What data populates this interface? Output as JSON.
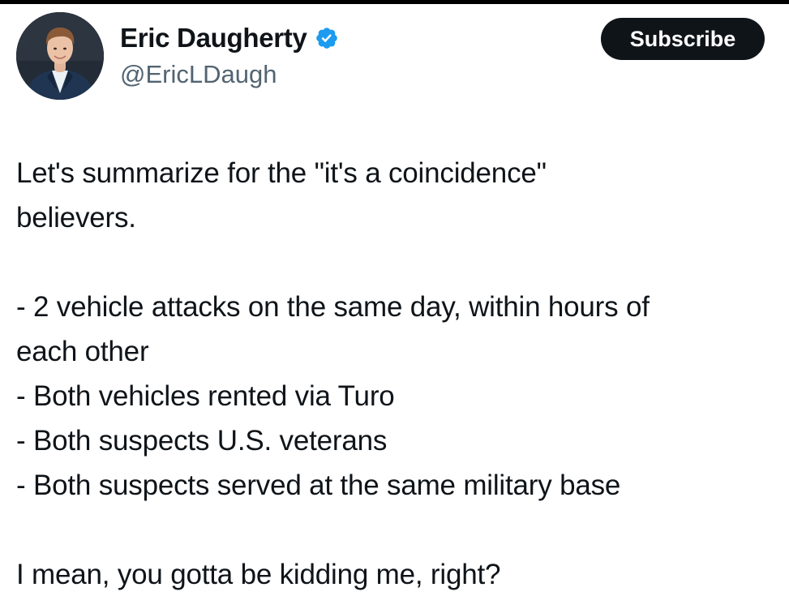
{
  "author": {
    "display_name": "Eric Daugherty",
    "handle": "@EricLDaugh",
    "verified": true,
    "verified_color": "#1d9bf0"
  },
  "actions": {
    "subscribe_label": "Subscribe"
  },
  "tweet": {
    "intro_lines": [
      "Let's summarize for the \"it's a coincidence\"",
      "believers."
    ],
    "list_lines": [
      "- 2 vehicle attacks on the same day, within hours of",
      "each other",
      "- Both vehicles rented via Turo",
      "- Both suspects U.S. veterans",
      "- Both suspects served at the same military base"
    ],
    "closing_line": "I mean, you gotta be kidding me, right?"
  },
  "icons": {
    "verified": "verified-badge-icon",
    "avatar": "profile-photo"
  }
}
